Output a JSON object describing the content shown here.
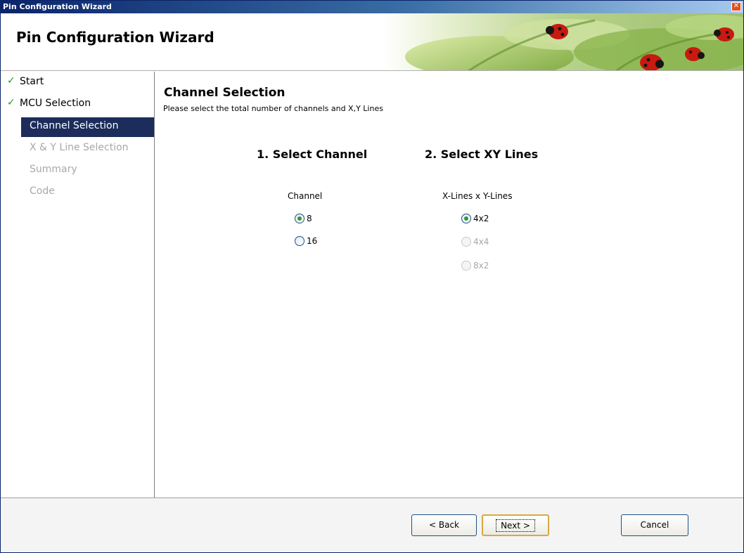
{
  "window": {
    "title": "Pin Configuration Wizard",
    "close_glyph": "✕"
  },
  "header": {
    "title": "Pin Configuration Wizard",
    "banner_art": "ladybugs-on-leaves"
  },
  "sidebar": {
    "items": [
      {
        "label": "Start",
        "state": "done",
        "icon": "check-icon"
      },
      {
        "label": "MCU Selection",
        "state": "done",
        "icon": "check-icon"
      },
      {
        "label": "Channel Selection",
        "state": "active"
      },
      {
        "label": "X & Y Line Selection",
        "state": "disabled"
      },
      {
        "label": "Summary",
        "state": "disabled"
      },
      {
        "label": "Code",
        "state": "disabled"
      }
    ],
    "check_glyph": "✓"
  },
  "main": {
    "title": "Channel Selection",
    "subtitle": "Please select the total number of channels and X,Y Lines",
    "channel": {
      "heading": "1. Select Channel",
      "group_label": "Channel",
      "options": [
        {
          "label": "8",
          "selected": true,
          "enabled": true
        },
        {
          "label": "16",
          "selected": false,
          "enabled": true
        }
      ]
    },
    "xy": {
      "heading": "2. Select XY Lines",
      "group_label": "X-Lines  x  Y-Lines",
      "options": [
        {
          "label": "4x2",
          "selected": true,
          "enabled": true
        },
        {
          "label": "4x4",
          "selected": false,
          "enabled": false
        },
        {
          "label": "8x2",
          "selected": false,
          "enabled": false
        }
      ]
    }
  },
  "footer": {
    "back_label": "< Back",
    "next_label": "Next >",
    "cancel_label": "Cancel"
  },
  "colors": {
    "nav_active_bg": "#1c2d5c",
    "check_green": "#2a9a2a",
    "radio_dot": "#2f9a2f",
    "disabled_text": "#a8a8a8"
  }
}
